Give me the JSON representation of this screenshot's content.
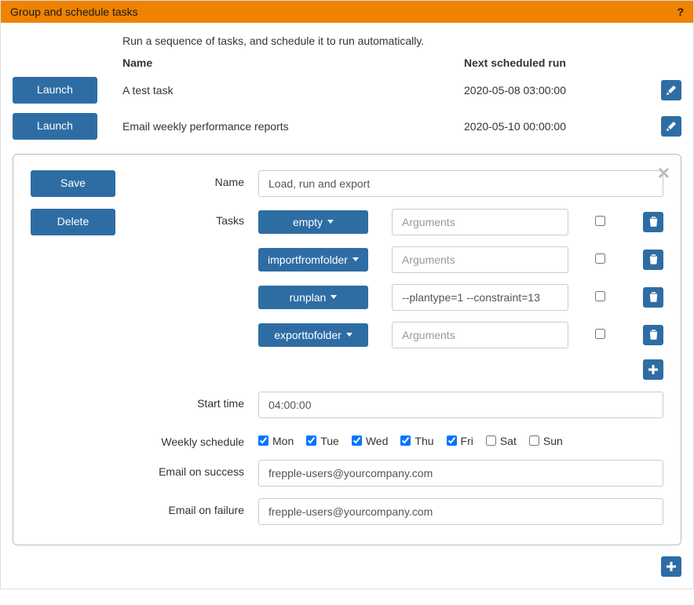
{
  "header": {
    "title": "Group and schedule tasks",
    "help": "?"
  },
  "description": "Run a sequence of tasks, and schedule it to run automatically.",
  "columns": {
    "name": "Name",
    "next": "Next scheduled run"
  },
  "buttons": {
    "launch": "Launch",
    "save": "Save",
    "delete": "Delete"
  },
  "tasks": [
    {
      "name": "A test task",
      "next": "2020-05-08 03:00:00"
    },
    {
      "name": "Email weekly performance reports",
      "next": "2020-05-10 00:00:00"
    }
  ],
  "editor": {
    "labels": {
      "name": "Name",
      "tasks": "Tasks",
      "start_time": "Start time",
      "weekly_schedule": "Weekly schedule",
      "email_success": "Email on success",
      "email_failure": "Email on failure"
    },
    "name_value": "Load, run and export",
    "task_rows": [
      {
        "type": "empty",
        "args": "",
        "placeholder": "Arguments",
        "checked": false
      },
      {
        "type": "importfromfolder",
        "args": "",
        "placeholder": "Arguments",
        "checked": false
      },
      {
        "type": "runplan",
        "args": "--plantype=1 --constraint=13",
        "placeholder": "Arguments",
        "checked": false
      },
      {
        "type": "exporttofolder",
        "args": "",
        "placeholder": "Arguments",
        "checked": false
      }
    ],
    "start_time": "04:00:00",
    "days": [
      {
        "label": "Mon",
        "checked": true
      },
      {
        "label": "Tue",
        "checked": true
      },
      {
        "label": "Wed",
        "checked": true
      },
      {
        "label": "Thu",
        "checked": true
      },
      {
        "label": "Fri",
        "checked": true
      },
      {
        "label": "Sat",
        "checked": false
      },
      {
        "label": "Sun",
        "checked": false
      }
    ],
    "email_success": "frepple-users@yourcompany.com",
    "email_failure": "frepple-users@yourcompany.com"
  }
}
